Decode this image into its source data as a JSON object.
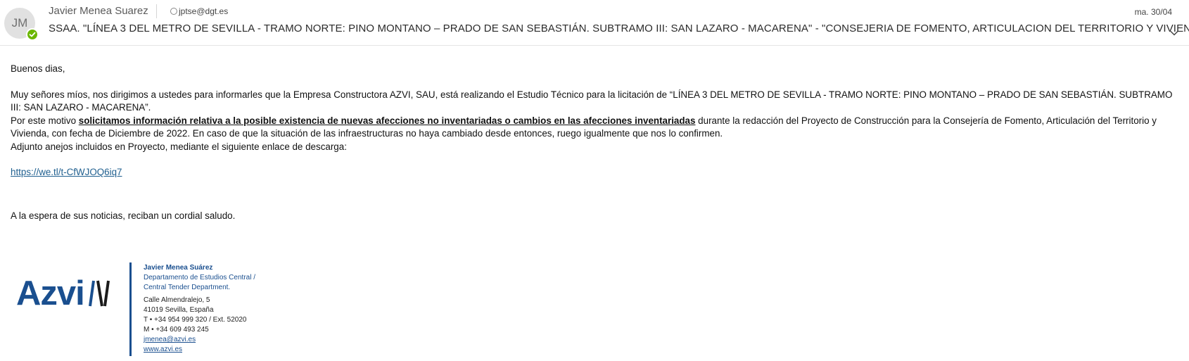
{
  "header": {
    "avatar_initials": "JM",
    "sender_name": "Javier Menea Suarez",
    "recipient": "jptse@dgt.es",
    "date": "ma. 30/04",
    "subject": "SSAA. \"LÍNEA 3 DEL METRO DE SEVILLA - TRAMO NORTE: PINO MONTANO – PRADO DE SAN SEBASTIÁN. SUBTRAMO III: SAN LAZARO - MACARENA\" - \"CONSEJERIA DE FOMENTO, ARTICULACION DEL TERRITORIO Y VIVIENDA\"",
    "presence_color": "#6bb700"
  },
  "body": {
    "greeting": "Buenos dias,",
    "para1": "Muy señores míos, nos dirigimos a ustedes para informarles que la Empresa Constructora AZVI, SAU, está realizando el Estudio Técnico para la licitación de “LÍNEA 3 DEL METRO DE SEVILLA - TRAMO NORTE: PINO MONTANO – PRADO DE SAN SEBASTIÁN. SUBTRAMO III: SAN LAZARO - MACARENA”.",
    "para2_pre": "Por este motivo ",
    "para2_bold": "solicitamos información relativa a la posible existencia de nuevas afecciones no inventariadas o cambios en las afecciones inventariadas",
    "para2_post": " durante la redacción del Proyecto de Construcción para la Consejería de Fomento, Articulación del Territorio y Vivienda, con fecha de Diciembre de 2022. En caso de que la situación de las infraestructuras no haya cambiado desde entonces, ruego igualmente que nos lo confirmen.",
    "para3": "Adjunto anejos incluidos en Proyecto, mediante el siguiente enlace de descarga:",
    "link": "https://we.tl/t-CfWJOQ6iq7",
    "closing": "A la espera de sus noticias, reciban un cordial saludo."
  },
  "signature": {
    "logo_text": "Azvi",
    "name": "Javier Menea Suárez",
    "dept_line1": "Departamento de Estudios Central /",
    "dept_line2": "Central Tender Department.",
    "address1": "Calle Almendralejo, 5",
    "address2": "41019 Sevilla, España",
    "phone": "T •  +34 954 999 320 / Ext. 52020",
    "mobile": "M •  +34 609 493 245",
    "email": "jmenea@azvi.es",
    "website": "www.azvi.es",
    "brand_color": "#1a4f8f"
  }
}
